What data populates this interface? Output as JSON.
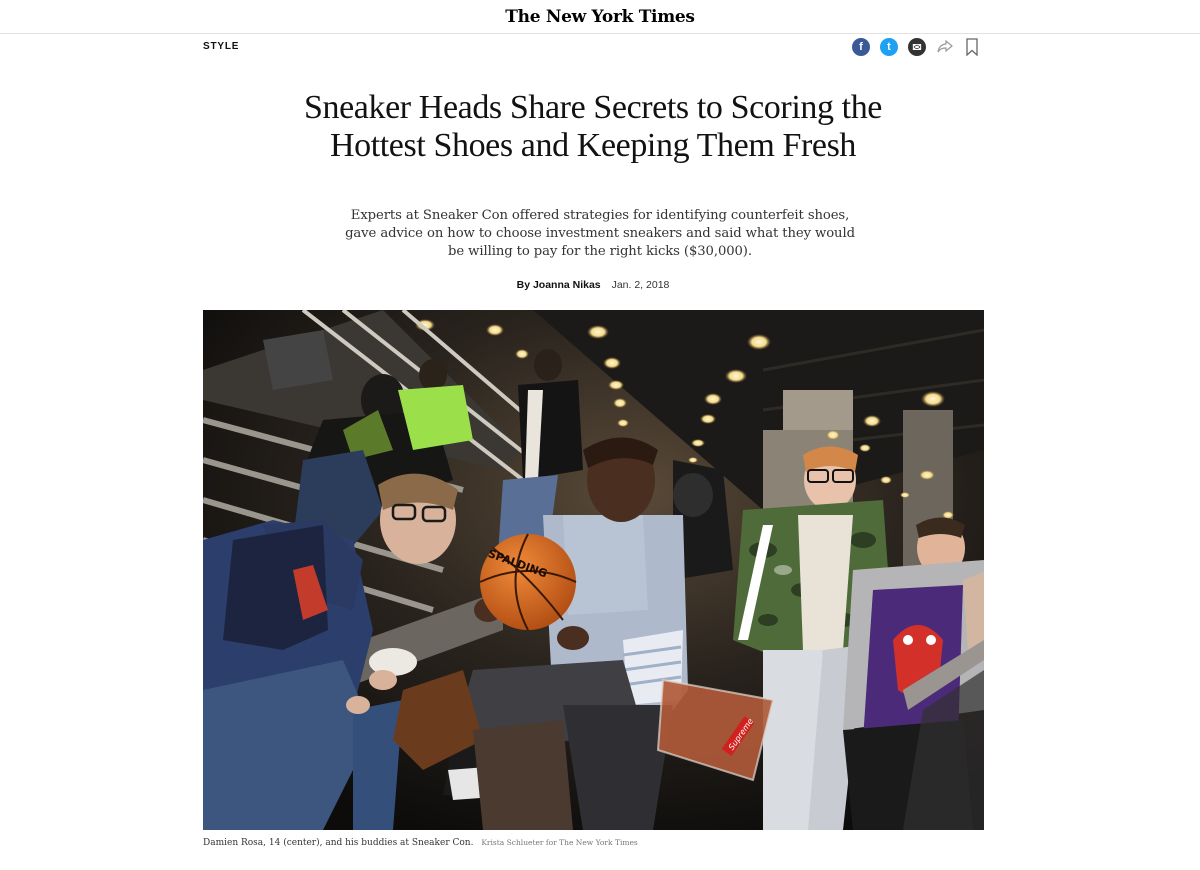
{
  "masthead": {
    "logo_text": "The New York Times"
  },
  "section": {
    "label": "STYLE"
  },
  "share": {
    "facebook_glyph": "f",
    "twitter_glyph": "t",
    "email_glyph": "✉",
    "icons": [
      "facebook-icon",
      "twitter-icon",
      "email-icon",
      "share-arrow-icon",
      "bookmark-icon"
    ]
  },
  "article": {
    "headline": "Sneaker Heads Share Secrets to Scoring the Hottest Shoes and Keeping Them Fresh",
    "summary": "Experts at Sneaker Con offered strategies for identifying counterfeit shoes, gave advice on how to choose investment sneakers and said what they would be willing to pay for the right kicks ($30,000).",
    "byline": "By Joanna Nikas",
    "date": "Jan. 2, 2018"
  },
  "photo": {
    "caption": "Damien Rosa, 14 (center), and his buddies at Sneaker Con.",
    "credit": "Krista Schlueter for The New York Times",
    "ball_text": "SPALDING",
    "bag_text": "Supreme"
  },
  "colors": {
    "facebook": "#3b5998",
    "twitter": "#1da1f2",
    "email": "#333333",
    "text": "#121212"
  }
}
